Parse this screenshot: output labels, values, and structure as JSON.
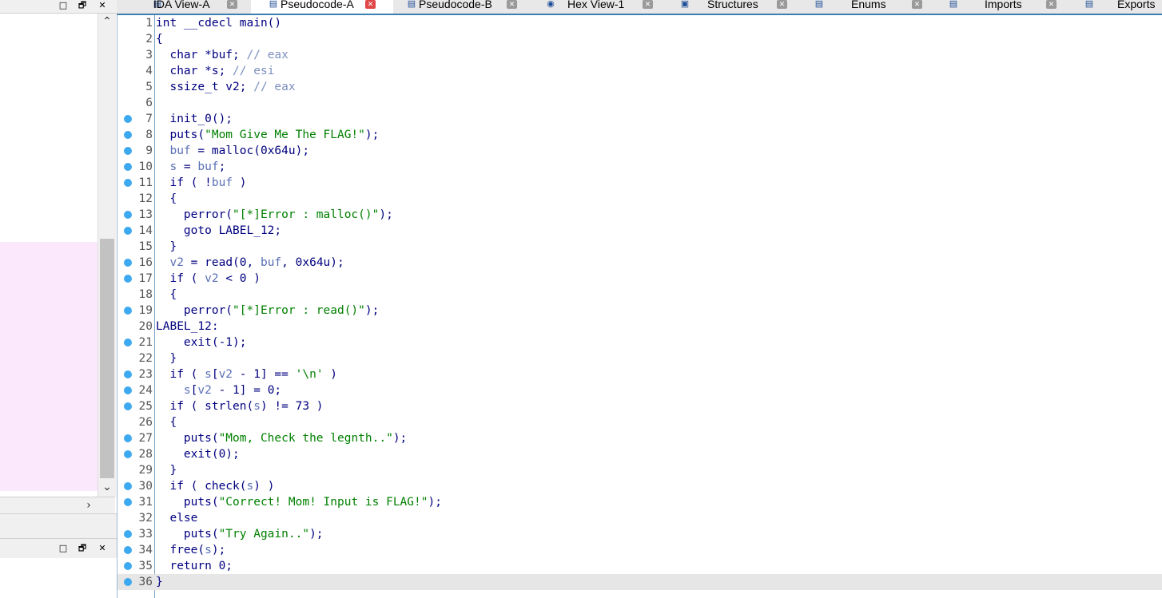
{
  "left_pane": {
    "top_controls": [
      "□",
      "🗗",
      "✕"
    ],
    "bottom_controls": [
      "□",
      "🗗",
      "✕"
    ]
  },
  "tabs": [
    {
      "label": "IDA View-A",
      "icon": "ida-view-icon",
      "active": false
    },
    {
      "label": "Pseudocode-A",
      "icon": "pseudocode-icon",
      "active": true
    },
    {
      "label": "Pseudocode-B",
      "icon": "pseudocode-icon",
      "active": false
    },
    {
      "label": "Hex View-1",
      "icon": "hex-view-icon",
      "active": false
    },
    {
      "label": "Structures",
      "icon": "structures-icon",
      "active": false
    },
    {
      "label": "Enums",
      "icon": "enums-icon",
      "active": false
    },
    {
      "label": "Imports",
      "icon": "imports-icon",
      "active": false
    },
    {
      "label": "Exports",
      "icon": "exports-icon",
      "active": false
    }
  ],
  "colors": {
    "keyword": "#000080",
    "string": "#008000",
    "variable": "#5a6fb5",
    "comment": "#7b8fbf",
    "breakpoint_dot": "#3da9f0",
    "highlight": "#fce8fc",
    "active_tab_close": "#e0484a",
    "tab_underline": "#3c7fb1"
  },
  "code": {
    "current_line": 36,
    "lines": [
      {
        "n": "1",
        "dot": false,
        "tokens": [
          [
            "pl",
            "int __cdecl main()"
          ]
        ]
      },
      {
        "n": "2",
        "dot": false,
        "tokens": [
          [
            "pl",
            "{"
          ]
        ]
      },
      {
        "n": "3",
        "dot": false,
        "tokens": [
          [
            "pl",
            "  char *buf; "
          ],
          [
            "cmt",
            "// eax"
          ]
        ]
      },
      {
        "n": "4",
        "dot": false,
        "tokens": [
          [
            "pl",
            "  char *s; "
          ],
          [
            "cmt",
            "// esi"
          ]
        ]
      },
      {
        "n": "5",
        "dot": false,
        "tokens": [
          [
            "pl",
            "  ssize_t v2; "
          ],
          [
            "cmt",
            "// eax"
          ]
        ]
      },
      {
        "n": "6",
        "dot": false,
        "tokens": [
          [
            "pl",
            ""
          ]
        ]
      },
      {
        "n": "7",
        "dot": true,
        "tokens": [
          [
            "pl",
            "  init_0();"
          ]
        ]
      },
      {
        "n": "8",
        "dot": true,
        "tokens": [
          [
            "pl",
            "  puts("
          ],
          [
            "str",
            "\"Mom Give Me The FLAG!\""
          ],
          [
            "pl",
            ");"
          ]
        ]
      },
      {
        "n": "9",
        "dot": true,
        "tokens": [
          [
            "pl",
            "  "
          ],
          [
            "var",
            "buf"
          ],
          [
            "pl",
            " = malloc(0x64u);"
          ]
        ]
      },
      {
        "n": "10",
        "dot": true,
        "tokens": [
          [
            "pl",
            "  "
          ],
          [
            "var",
            "s"
          ],
          [
            "pl",
            " = "
          ],
          [
            "var",
            "buf"
          ],
          [
            "pl",
            ";"
          ]
        ]
      },
      {
        "n": "11",
        "dot": true,
        "tokens": [
          [
            "pl",
            "  if ( !"
          ],
          [
            "var",
            "buf"
          ],
          [
            "pl",
            " )"
          ]
        ]
      },
      {
        "n": "12",
        "dot": false,
        "tokens": [
          [
            "pl",
            "  {"
          ]
        ]
      },
      {
        "n": "13",
        "dot": true,
        "tokens": [
          [
            "pl",
            "    perror("
          ],
          [
            "str",
            "\"[*]Error : malloc()\""
          ],
          [
            "pl",
            ");"
          ]
        ]
      },
      {
        "n": "14",
        "dot": true,
        "tokens": [
          [
            "pl",
            "    goto LABEL_12;"
          ]
        ]
      },
      {
        "n": "15",
        "dot": false,
        "tokens": [
          [
            "pl",
            "  }"
          ]
        ]
      },
      {
        "n": "16",
        "dot": true,
        "tokens": [
          [
            "pl",
            "  "
          ],
          [
            "var",
            "v2"
          ],
          [
            "pl",
            " = read(0, "
          ],
          [
            "var",
            "buf"
          ],
          [
            "pl",
            ", 0x64u);"
          ]
        ]
      },
      {
        "n": "17",
        "dot": true,
        "tokens": [
          [
            "pl",
            "  if ( "
          ],
          [
            "var",
            "v2"
          ],
          [
            "pl",
            " < 0 )"
          ]
        ]
      },
      {
        "n": "18",
        "dot": false,
        "tokens": [
          [
            "pl",
            "  {"
          ]
        ]
      },
      {
        "n": "19",
        "dot": true,
        "tokens": [
          [
            "pl",
            "    perror("
          ],
          [
            "str",
            "\"[*]Error : read()\""
          ],
          [
            "pl",
            ");"
          ]
        ]
      },
      {
        "n": "20",
        "dot": false,
        "tokens": [
          [
            "pl",
            "LABEL_12:"
          ]
        ]
      },
      {
        "n": "21",
        "dot": true,
        "tokens": [
          [
            "pl",
            "    exit(-1);"
          ]
        ]
      },
      {
        "n": "22",
        "dot": false,
        "tokens": [
          [
            "pl",
            "  }"
          ]
        ]
      },
      {
        "n": "23",
        "dot": true,
        "tokens": [
          [
            "pl",
            "  if ( "
          ],
          [
            "var",
            "s"
          ],
          [
            "pl",
            "["
          ],
          [
            "var",
            "v2"
          ],
          [
            "pl",
            " - 1] == "
          ],
          [
            "str",
            "'\\n'"
          ],
          [
            "pl",
            " )"
          ]
        ]
      },
      {
        "n": "24",
        "dot": true,
        "tokens": [
          [
            "pl",
            "    "
          ],
          [
            "var",
            "s"
          ],
          [
            "pl",
            "["
          ],
          [
            "var",
            "v2"
          ],
          [
            "pl",
            " - 1] = 0;"
          ]
        ]
      },
      {
        "n": "25",
        "dot": true,
        "tokens": [
          [
            "pl",
            "  if ( strlen("
          ],
          [
            "var",
            "s"
          ],
          [
            "pl",
            ") != 73 )"
          ]
        ]
      },
      {
        "n": "26",
        "dot": false,
        "tokens": [
          [
            "pl",
            "  {"
          ]
        ]
      },
      {
        "n": "27",
        "dot": true,
        "tokens": [
          [
            "pl",
            "    puts("
          ],
          [
            "str",
            "\"Mom, Check the legnth..\""
          ],
          [
            "pl",
            ");"
          ]
        ]
      },
      {
        "n": "28",
        "dot": true,
        "tokens": [
          [
            "pl",
            "    exit(0);"
          ]
        ]
      },
      {
        "n": "29",
        "dot": false,
        "tokens": [
          [
            "pl",
            "  }"
          ]
        ]
      },
      {
        "n": "30",
        "dot": true,
        "tokens": [
          [
            "pl",
            "  if ( check("
          ],
          [
            "var",
            "s"
          ],
          [
            "pl",
            ") )"
          ]
        ]
      },
      {
        "n": "31",
        "dot": true,
        "tokens": [
          [
            "pl",
            "    puts("
          ],
          [
            "str",
            "\"Correct! Mom! Input is FLAG!\""
          ],
          [
            "pl",
            ");"
          ]
        ]
      },
      {
        "n": "32",
        "dot": false,
        "tokens": [
          [
            "pl",
            "  else"
          ]
        ]
      },
      {
        "n": "33",
        "dot": true,
        "tokens": [
          [
            "pl",
            "    puts("
          ],
          [
            "str",
            "\"Try Again..\""
          ],
          [
            "pl",
            ");"
          ]
        ]
      },
      {
        "n": "34",
        "dot": true,
        "tokens": [
          [
            "pl",
            "  free("
          ],
          [
            "var",
            "s"
          ],
          [
            "pl",
            ");"
          ]
        ]
      },
      {
        "n": "35",
        "dot": true,
        "tokens": [
          [
            "pl",
            "  return 0;"
          ]
        ]
      },
      {
        "n": "36",
        "dot": true,
        "tokens": [
          [
            "pl",
            "}"
          ]
        ]
      }
    ]
  }
}
